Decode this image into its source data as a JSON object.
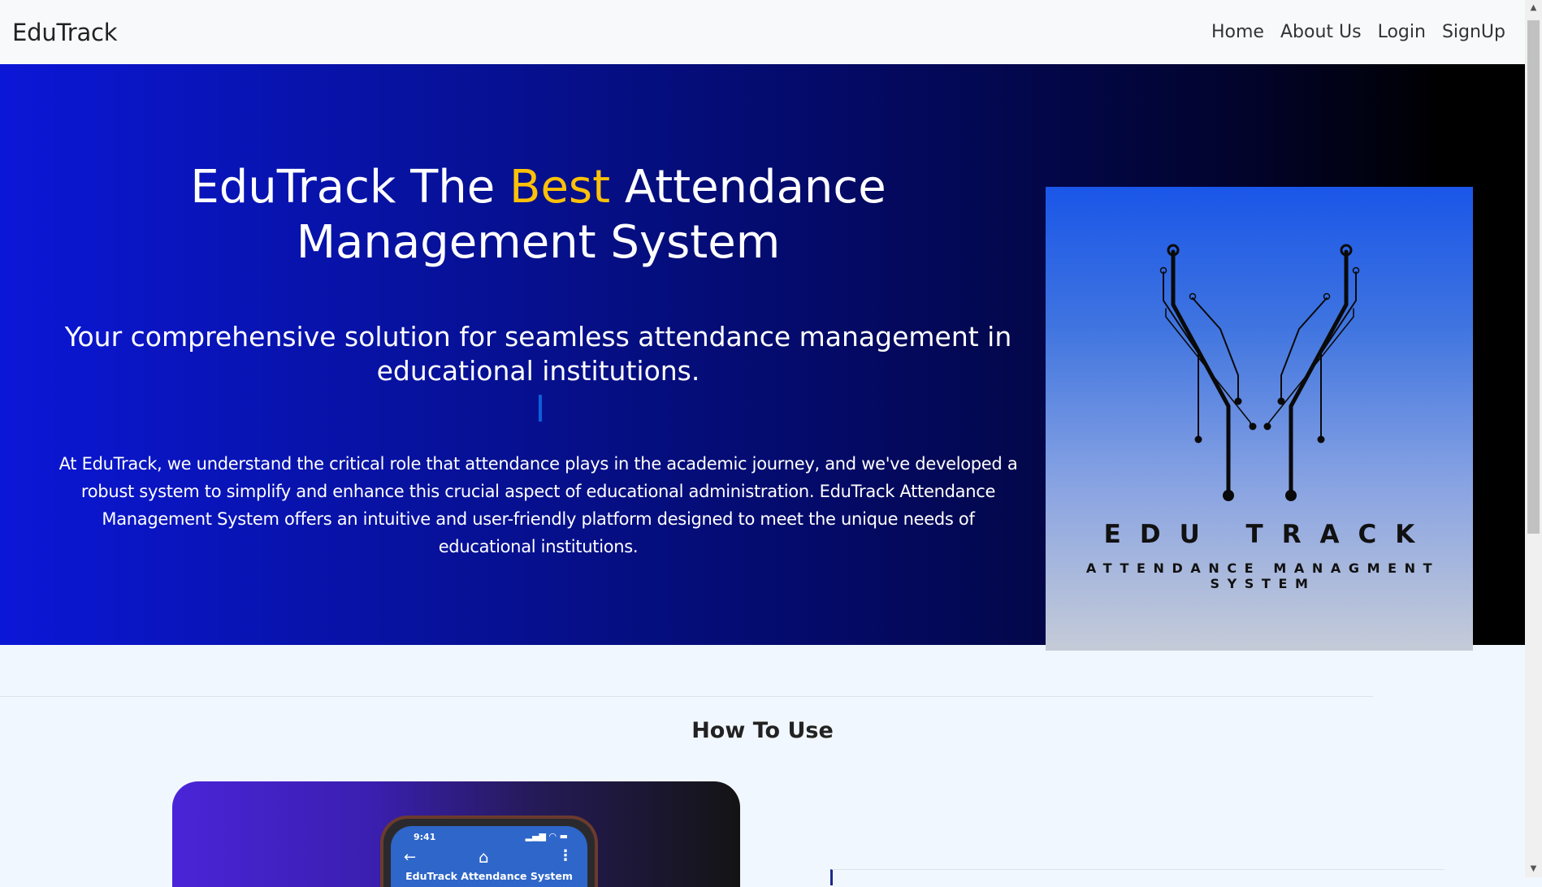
{
  "navbar": {
    "brand": "EduTrack",
    "links": [
      {
        "label": "Home"
      },
      {
        "label": "About Us"
      },
      {
        "label": "Login"
      },
      {
        "label": "SignUp"
      }
    ]
  },
  "hero": {
    "title_before": "EduTrack The ",
    "title_accent": "Best",
    "title_after": " Attendance Management System",
    "subtitle": "Your comprehensive solution for seamless attendance management in educational institutions.",
    "body": "At EduTrack, we understand the critical role that attendance plays in the academic journey, and we've developed a robust system to simplify and enhance this crucial aspect of educational administration. EduTrack Attendance Management System offers an intuitive and user-friendly platform designed to meet the unique needs of educational institutions.",
    "logo": {
      "word": "EDU TRACK",
      "tagline": "ATTENDANCE MANAGMENT SYSTEM"
    }
  },
  "how_to_use": {
    "title": "How To Use",
    "phone": {
      "time": "9:41",
      "app_title": "EduTrack Attendance System"
    }
  },
  "colors": {
    "accent": "#ffc107",
    "hero_start": "#0b17d6",
    "hero_end": "#000000"
  }
}
